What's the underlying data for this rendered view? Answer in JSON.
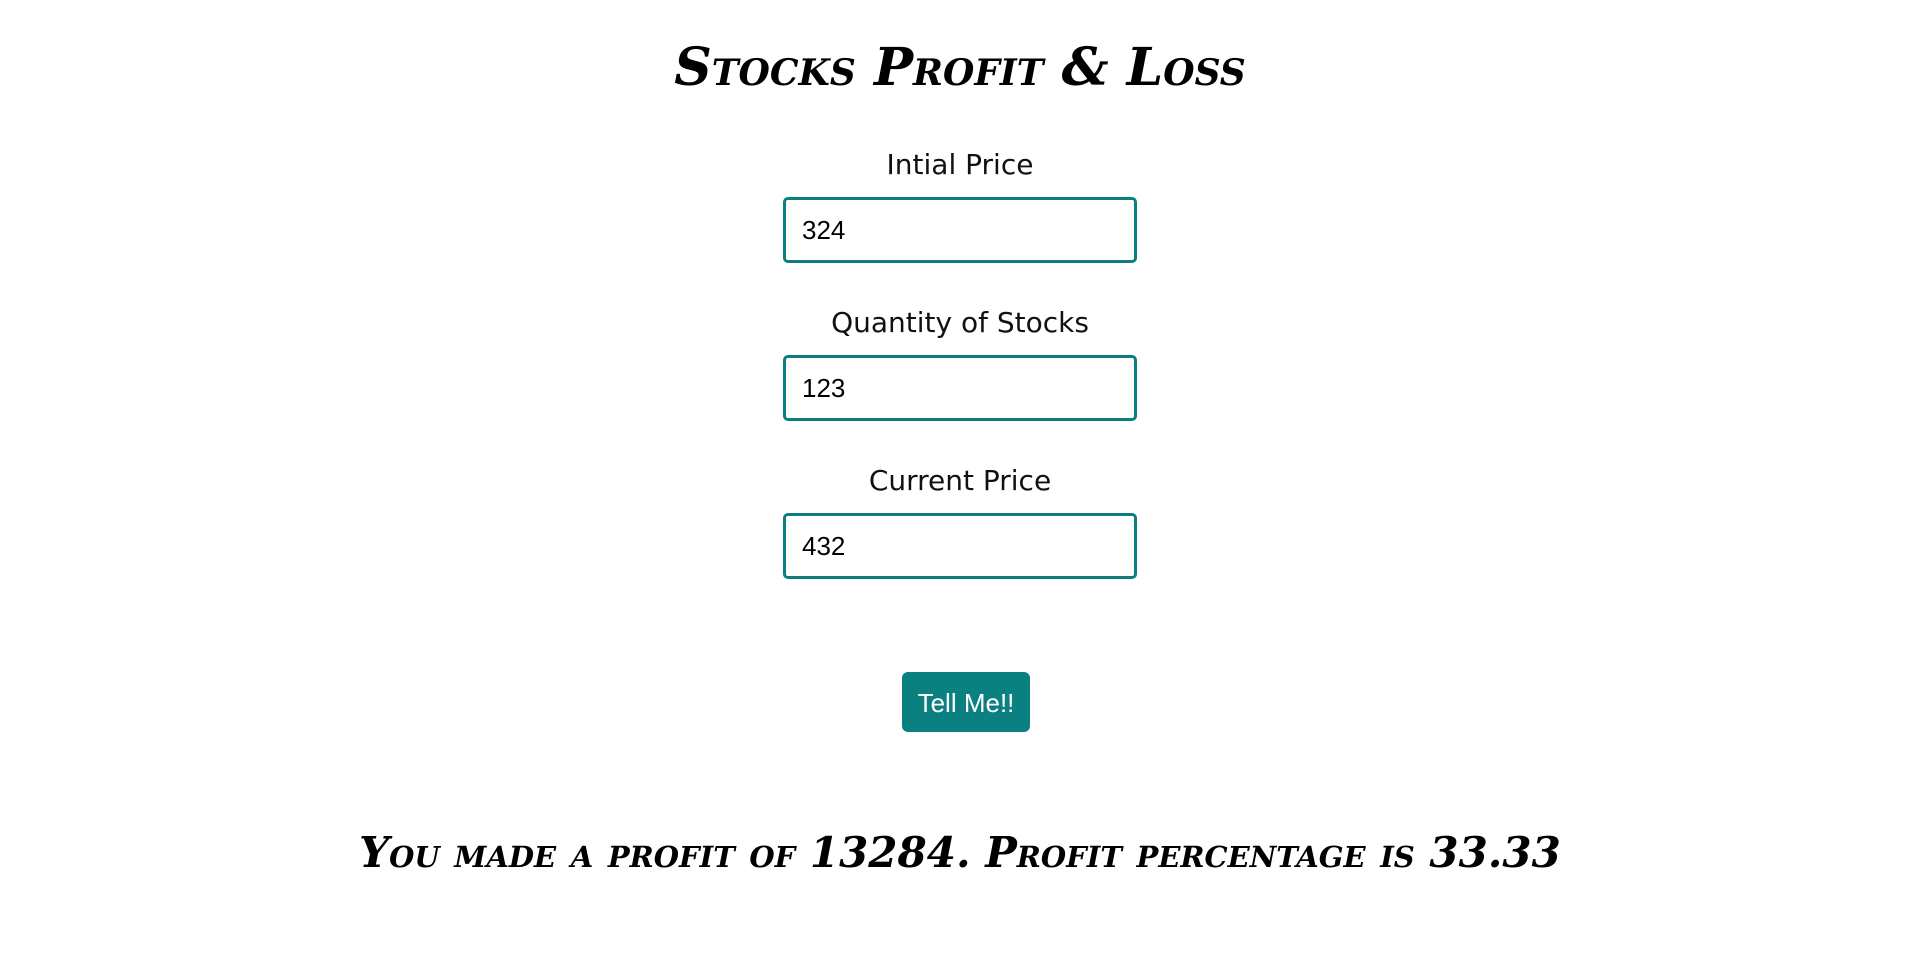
{
  "page": {
    "title": "Stocks Profit & Loss"
  },
  "form": {
    "fields": [
      {
        "label": "Intial Price",
        "value": "324"
      },
      {
        "label": "Quantity of Stocks",
        "value": "123"
      },
      {
        "label": "Current Price",
        "value": "432"
      }
    ],
    "submit_label": "Tell Me!!"
  },
  "output": {
    "message": "You made a profit of 13284. Profit percentage is 33.33"
  },
  "colors": {
    "accent": "#0b8080",
    "input_border": "#0b7f7f",
    "background": "#ffffff",
    "text": "#000000"
  }
}
